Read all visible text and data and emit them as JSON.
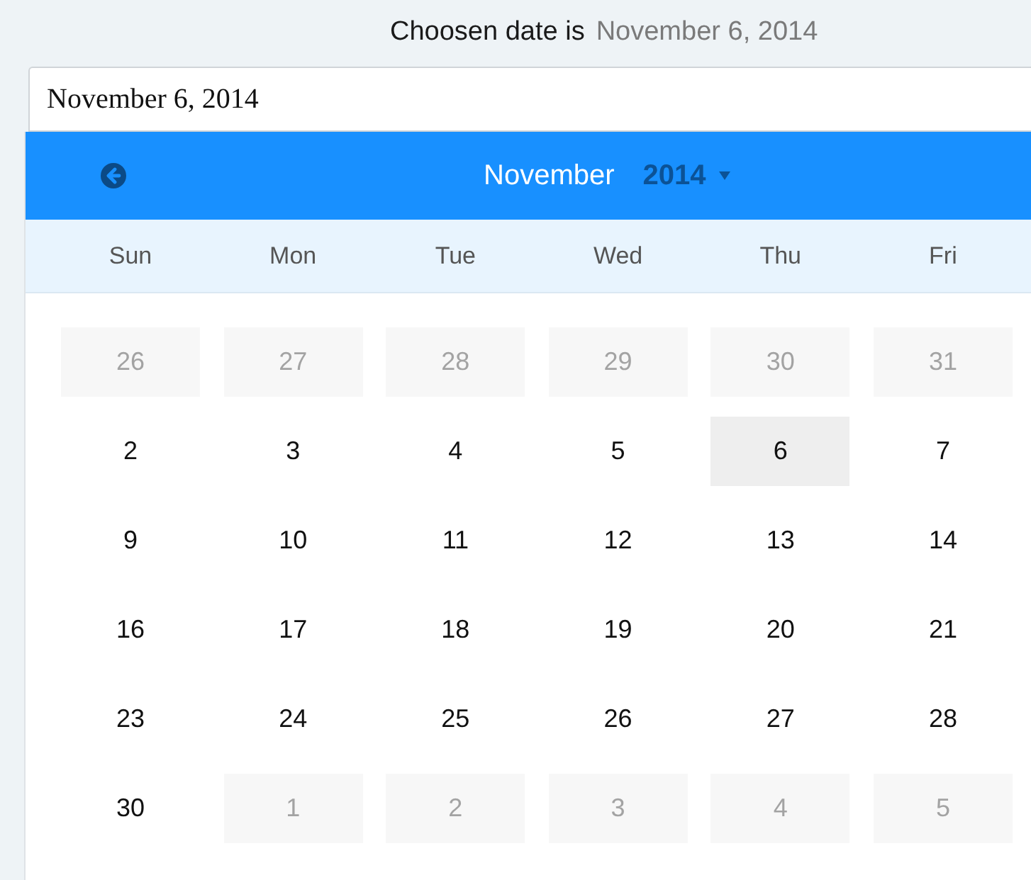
{
  "header": {
    "label": "Choosen date is",
    "value": "November 6, 2014"
  },
  "date_input": {
    "value": "November 6, 2014"
  },
  "calendar": {
    "month": "November",
    "year": "2014",
    "weekdays": [
      "Sun",
      "Mon",
      "Tue",
      "Wed",
      "Thu",
      "Fri"
    ],
    "weeks": [
      [
        {
          "day": "26",
          "outside": true,
          "selected": false
        },
        {
          "day": "27",
          "outside": true,
          "selected": false
        },
        {
          "day": "28",
          "outside": true,
          "selected": false
        },
        {
          "day": "29",
          "outside": true,
          "selected": false
        },
        {
          "day": "30",
          "outside": true,
          "selected": false
        },
        {
          "day": "31",
          "outside": true,
          "selected": false
        }
      ],
      [
        {
          "day": "2",
          "outside": false,
          "selected": false
        },
        {
          "day": "3",
          "outside": false,
          "selected": false
        },
        {
          "day": "4",
          "outside": false,
          "selected": false
        },
        {
          "day": "5",
          "outside": false,
          "selected": false
        },
        {
          "day": "6",
          "outside": false,
          "selected": true
        },
        {
          "day": "7",
          "outside": false,
          "selected": false
        }
      ],
      [
        {
          "day": "9",
          "outside": false,
          "selected": false
        },
        {
          "day": "10",
          "outside": false,
          "selected": false
        },
        {
          "day": "11",
          "outside": false,
          "selected": false
        },
        {
          "day": "12",
          "outside": false,
          "selected": false
        },
        {
          "day": "13",
          "outside": false,
          "selected": false
        },
        {
          "day": "14",
          "outside": false,
          "selected": false
        }
      ],
      [
        {
          "day": "16",
          "outside": false,
          "selected": false
        },
        {
          "day": "17",
          "outside": false,
          "selected": false
        },
        {
          "day": "18",
          "outside": false,
          "selected": false
        },
        {
          "day": "19",
          "outside": false,
          "selected": false
        },
        {
          "day": "20",
          "outside": false,
          "selected": false
        },
        {
          "day": "21",
          "outside": false,
          "selected": false
        }
      ],
      [
        {
          "day": "23",
          "outside": false,
          "selected": false
        },
        {
          "day": "24",
          "outside": false,
          "selected": false
        },
        {
          "day": "25",
          "outside": false,
          "selected": false
        },
        {
          "day": "26",
          "outside": false,
          "selected": false
        },
        {
          "day": "27",
          "outside": false,
          "selected": false
        },
        {
          "day": "28",
          "outside": false,
          "selected": false
        }
      ],
      [
        {
          "day": "30",
          "outside": false,
          "selected": false
        },
        {
          "day": "1",
          "outside": true,
          "selected": false
        },
        {
          "day": "2",
          "outside": true,
          "selected": false
        },
        {
          "day": "3",
          "outside": true,
          "selected": false
        },
        {
          "day": "4",
          "outside": true,
          "selected": false
        },
        {
          "day": "5",
          "outside": true,
          "selected": false
        }
      ]
    ]
  }
}
